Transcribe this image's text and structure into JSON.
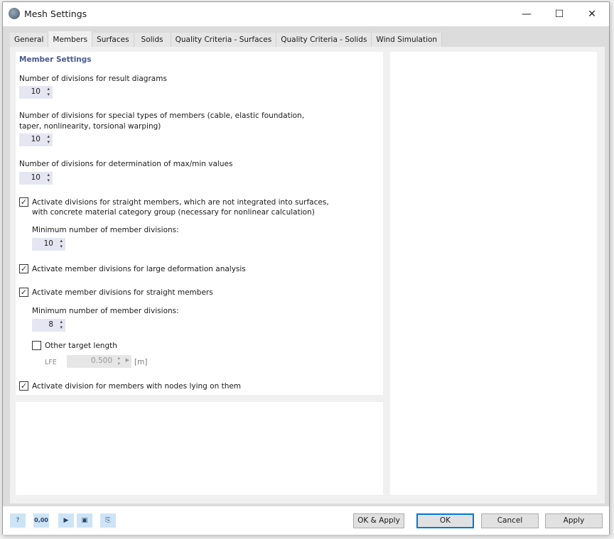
{
  "window": {
    "title": "Mesh Settings",
    "minimize": "—",
    "maximize": "☐",
    "close": "✕"
  },
  "tabs": [
    {
      "label": "General"
    },
    {
      "label": "Members"
    },
    {
      "label": "Surfaces"
    },
    {
      "label": "Solids"
    },
    {
      "label": "Quality Criteria - Surfaces"
    },
    {
      "label": "Quality Criteria - Solids"
    },
    {
      "label": "Wind Simulation"
    }
  ],
  "active_tab": "Members",
  "members": {
    "section_title": "Member Settings",
    "result_diagrams": {
      "label": "Number of divisions for result diagrams",
      "value": "10"
    },
    "special_types": {
      "label1": "Number of divisions for special types of members (cable, elastic foundation,",
      "label2": "taper, nonlinearity, torsional warping)",
      "value": "10"
    },
    "max_min": {
      "label": "Number of divisions for determination of max/min values",
      "value": "10"
    },
    "concrete": {
      "checked": true,
      "label1": "Activate divisions for straight members, which are not integrated into surfaces,",
      "label2": "with concrete material category group (necessary for nonlinear calculation)",
      "min_label": "Minimum number of member divisions:",
      "value": "10"
    },
    "large_deformation": {
      "checked": true,
      "label": "Activate member divisions for large deformation analysis"
    },
    "straight": {
      "checked": true,
      "label": "Activate member divisions for straight members",
      "min_label": "Minimum number of member divisions:",
      "value": "8"
    },
    "target_length": {
      "checked": false,
      "label": "Other target length",
      "lfe_label": "LFE",
      "lfe_value": "0.500",
      "unit": "[m]"
    },
    "nodes_on_members": {
      "checked": true,
      "label": "Activate division for members with nodes lying on them"
    }
  },
  "footer": {
    "icons": [
      "help-icon",
      "units-icon",
      "load-icon",
      "save-icon",
      "copy-icon"
    ],
    "units_text": "0,00",
    "ok_apply": "OK & Apply",
    "ok": "OK",
    "cancel": "Cancel",
    "apply": "Apply"
  },
  "colors": {
    "section_title": "#4a5a8c",
    "spin_bg": "#e5e6f2",
    "default_button_border": "#0078d7"
  }
}
